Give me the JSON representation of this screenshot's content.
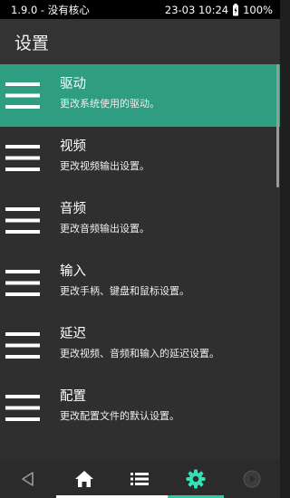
{
  "status": {
    "left": "1.9.0 - 没有核心",
    "time": "23-03 10:24",
    "battery": "100%"
  },
  "header": {
    "title": "设置"
  },
  "settings": {
    "items": [
      {
        "title": "驱动",
        "desc": "更改系统使用的驱动。"
      },
      {
        "title": "视频",
        "desc": "更改视频输出设置。"
      },
      {
        "title": "音频",
        "desc": "更改音频输出设置。"
      },
      {
        "title": "输入",
        "desc": "更改手柄、键盘和鼠标设置。"
      },
      {
        "title": "延迟",
        "desc": "更改视频、音频和输入的延迟设置。"
      },
      {
        "title": "配置",
        "desc": "更改配置文件的默认设置。"
      }
    ]
  },
  "bottom_nav": {
    "icons": [
      "back-icon",
      "home-icon",
      "list-icon",
      "gear-icon",
      "play-icon"
    ],
    "active": "gear-icon"
  },
  "colors": {
    "accent": "#2e9d80",
    "active_icon": "#35e0b6",
    "underline_white": "#ffffff",
    "underline_accent": "#2ec9a6"
  }
}
